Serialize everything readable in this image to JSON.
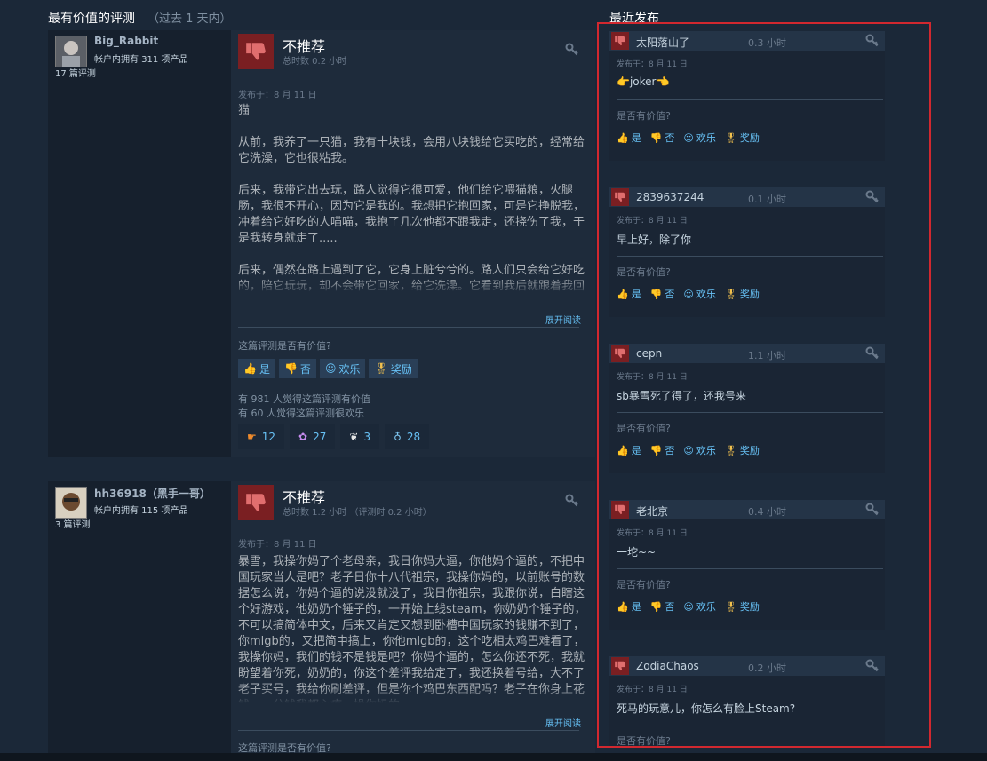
{
  "headings": {
    "most_helpful": "最有价值的评测",
    "period": "（过去 1 天内）",
    "recent": "最近发布"
  },
  "common": {
    "posted_prefix": "发布于：",
    "expand_label": "展开阅读",
    "helpful_question_main": "这篇评测是否有价值?",
    "helpful_question_recent": "是否有价值?",
    "vote_yes": "是",
    "vote_no": "否",
    "vote_funny": "欢乐",
    "vote_award": "奖励"
  },
  "reviews": [
    {
      "username": "Big_Rabbit",
      "owned": "帐户内拥有 311 项产品",
      "count": "17 篇评测",
      "verdict": "不推荐",
      "hours": "总时数 0.2 小时",
      "posted_date": "8 月 11 日",
      "paragraphs": [
        "猫",
        "从前，我养了一只猫，我有十块钱，会用八块钱给它买吃的，经常给它洗澡，它也很粘我。",
        "后来，我带它出去玩，路人觉得它很可爱，他们给它喂猫粮，火腿肠，我很不开心，因为它是我的。我想把它抱回家，可是它挣脱我，冲着给它好吃的人喵喵，我抱了几次他都不跟我走，还挠伤了我，于是我转身就走了.....",
        "后来，偶然在路上遇到了它，它身上脏兮兮的。路人们只会给它好吃的，陪它玩玩，却不会带它回家，给它洗澡。它看到我后就跟着我回家，我把它关在了门外，它在门外喵喵地叫着，叫的我很难受。"
      ],
      "stats_helpful": "有 981 人觉得这篇评测有价值",
      "stats_funny": "有 60 人觉得这篇评测很欢乐",
      "awards": [
        "12",
        "27",
        "3",
        "28"
      ]
    },
    {
      "username": "hh36918（黑手一哥）",
      "owned": "帐户内拥有 115 项产品",
      "count": "3 篇评测",
      "verdict": "不推荐",
      "hours": "总时数 1.2 小时 （评测时 0.2 小时）",
      "posted_date": "8 月 11 日",
      "paragraphs": [
        "暴雪，我操你妈了个老母亲，我日你妈大逼，你他妈个逼的，不把中国玩家当人是吧？老子日你十八代祖宗，我操你妈的，以前账号的数据怎么说，你妈个逼的说没就没了，我日你祖宗，我跟你说，白瞎这个好游戏，他奶奶个锤子的，一开始上线steam，你奶奶个锤子的，不可以搞简体中文，后来又肯定又想到卧槽中国玩家的钱赚不到了，你mlgb的，又把简中搞上，你他mlgb的，这个吃相太鸡巴难看了，我操你妈，我们的钱不是钱是吧？你妈个逼的，怎么你还不死，我就盼望着你死，奶奶的，你这个差评我给定了，我还换着号给，大不了老子买号，我给你刷差评，但是你个鸡巴东西配吗？老子在你身上花钱，一分钱我都心疼，操你妈的"
      ]
    }
  ],
  "recent": [
    {
      "name": "太阳落山了",
      "hours": "0.3 小时",
      "posted_date": "8 月 11 日",
      "body": "👉joker👈"
    },
    {
      "name": "2839637244",
      "hours": "0.1 小时",
      "posted_date": "8 月 11 日",
      "body": "早上好，除了你"
    },
    {
      "name": "cepn",
      "hours": "1.1 小时",
      "posted_date": "8 月 11 日",
      "body": "sb暴雪死了得了，还我号来"
    },
    {
      "name": "老北京",
      "hours": "0.4 小时",
      "posted_date": "8 月 11 日",
      "body": "一坨~~"
    },
    {
      "name": "ZodiaChaos",
      "hours": "0.2 小时",
      "posted_date": "8 月 11 日",
      "body": "死马的玩意儿，你怎么有脸上Steam?"
    }
  ],
  "colors": {
    "background": "#1b2838",
    "thumb_down": "#7a1f22",
    "link": "#67c1f5",
    "highlight_box": "#d2282f"
  }
}
